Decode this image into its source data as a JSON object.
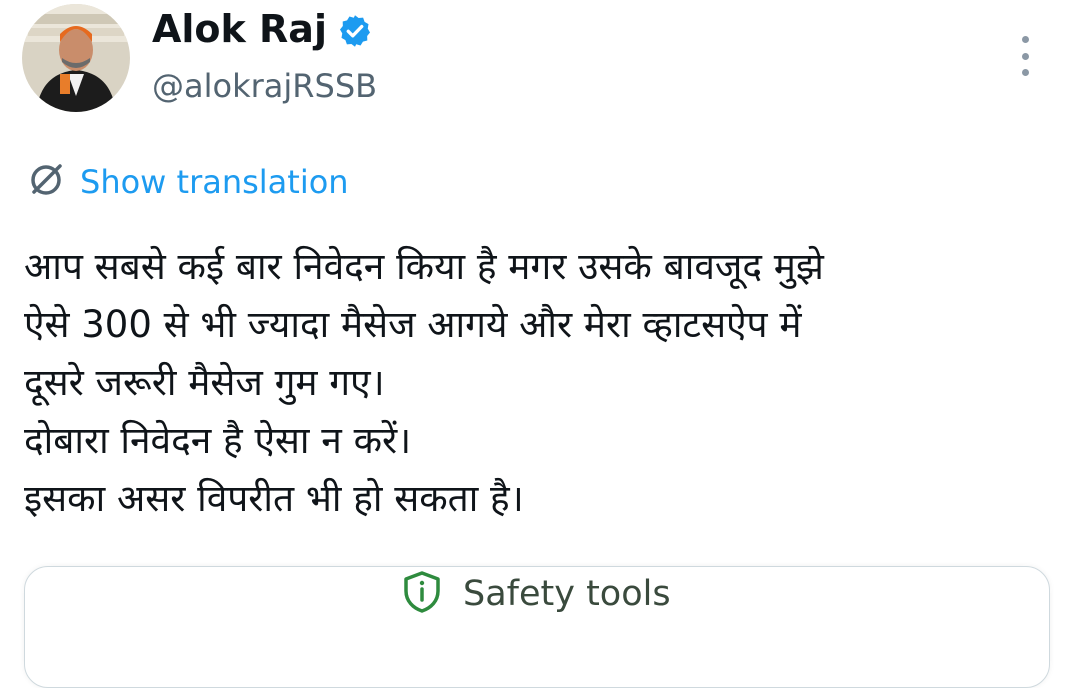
{
  "author": {
    "display_name": "Alok Raj",
    "handle": "@alokrajRSSB"
  },
  "translate": {
    "label": "Show translation",
    "icon": "translate-icon"
  },
  "tweet": {
    "lines": [
      "आप सबसे कई बार निवेदन किया है मगर उसके बावजूद मुझे",
      "ऐसे 300 से भी ज्यादा मैसेज आगये और मेरा व्हाटसऐप में",
      "दूसरे जरूरी मैसेज गुम गए।",
      "दोबारा निवेदन है ऐसा न करें।",
      "इसका असर विपरीत भी हो सकता है।"
    ]
  },
  "attachment": {
    "safety_label": "Safety tools",
    "icon": "safety-info-icon"
  },
  "colors": {
    "link": "#1d9bf0",
    "verified": "#1d9bf0",
    "muted": "#536471"
  }
}
